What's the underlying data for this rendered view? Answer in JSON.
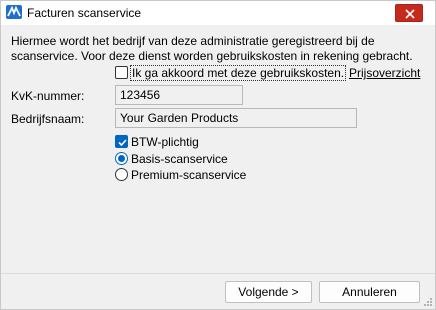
{
  "window": {
    "title": "Facturen scanservice",
    "app_icon": "app-logo-icon",
    "close_icon": "close-icon"
  },
  "intro": {
    "line1": "Hiermee wordt het bedrijf van deze administratie geregistreerd bij de",
    "line2": "scanservice. Voor deze dienst worden gebruikskosten in rekening gebracht."
  },
  "agreement": {
    "label": "Ik ga akkoord met deze gebruikskosten.",
    "checked": false,
    "link": "Prijsoverzicht"
  },
  "fields": {
    "kvk_label": "KvK-nummer:",
    "kvk_value": "123456",
    "name_label": "Bedrijfsnaam:",
    "name_value": "Your Garden Products"
  },
  "options": {
    "btw_label": "BTW-plichtig",
    "btw_checked": true,
    "basis_label": "Basis-scanservice",
    "premium_label": "Premium-scanservice",
    "selected": "Basis-scanservice"
  },
  "buttons": {
    "next": "Volgende >",
    "cancel": "Annuleren"
  },
  "colors": {
    "accent": "#0067c0",
    "close": "#c42b1c",
    "dialog_bg": "#f0f0f0"
  }
}
